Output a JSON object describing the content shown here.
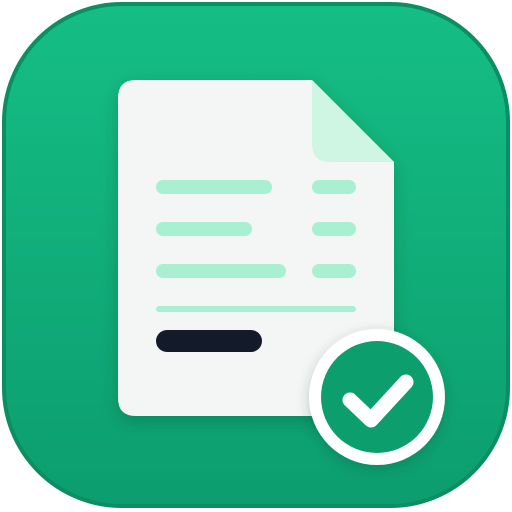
{
  "app_icon": {
    "icon": "invoice-approved-icon",
    "colors": {
      "tile_top": "#15BE85",
      "tile_bottom": "#0C9D6E",
      "tile_edge": "#0A8E62",
      "document": "#F4F6F5",
      "fold": "#CFF5E3",
      "line_accent": "#A8F0D1",
      "total_bar": "#131A2A",
      "badge_fill": "#119E6D",
      "badge_ring": "#FFFFFF",
      "check": "#FFFFFF"
    }
  }
}
